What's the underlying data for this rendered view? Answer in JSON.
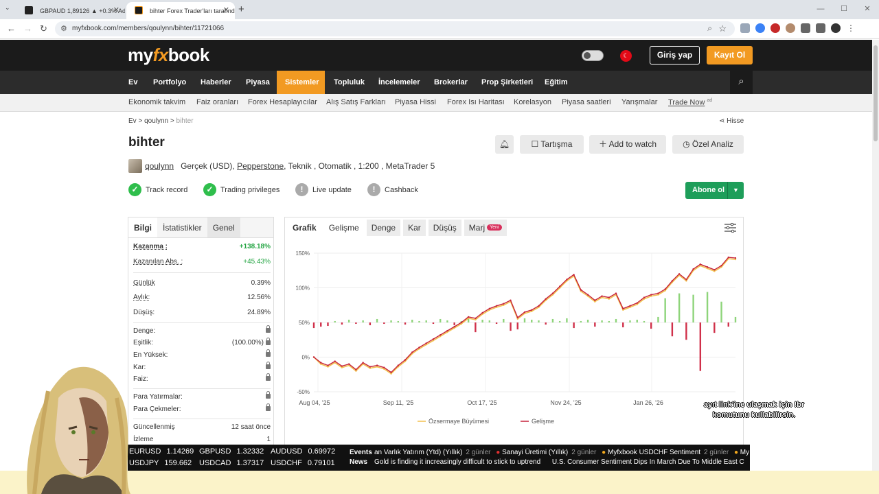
{
  "browser": {
    "tabs": [
      {
        "title": "GBPAUD 1,89126 ▲ +0.3% Adsız",
        "active": false
      },
      {
        "title": "bihter Forex Trader'ları tarafından",
        "active": true
      }
    ],
    "url": "myfxbook.com/members/qoulynn/bihter/11721066"
  },
  "header": {
    "logo": {
      "a": "my",
      "b": "fx",
      "c": "book"
    },
    "login": "Giriş yap",
    "register": "Kayıt Ol"
  },
  "nav": {
    "items": [
      "Ev",
      "Portfolyo",
      "Haberler",
      "Piyasa",
      "Sistemler",
      "Topluluk",
      "İncelemeler",
      "Brokerlar",
      "Prop Şirketleri",
      "Eğitim"
    ],
    "active": "Sistemler"
  },
  "subnav": {
    "items": [
      "Ekonomik takvim",
      "Faiz oranları",
      "Forex Hesaplayıcılar",
      "Alış Satış Farkları",
      "Piyasa Hissi",
      "Forex Isı Haritası",
      "Korelasyon",
      "Piyasa saatleri",
      "Yarışmalar",
      "Trade Now"
    ],
    "ad": "ad"
  },
  "breadcrumb": {
    "home": "Ev",
    "user": "qoulynn",
    "current": "bihter",
    "share": "Hisse"
  },
  "system": {
    "name": "bihter",
    "user": "qoulynn",
    "account_type": "Gerçek (USD),",
    "broker": "Pepperstone",
    "details": ", Teknik , Otomatik , 1:200 , MetaTrader 5"
  },
  "actions": {
    "discussion": "Tartışma",
    "watch": "Add to watch",
    "analysis": "Özel Analiz"
  },
  "badges": [
    {
      "label": "Track record",
      "status": "ok"
    },
    {
      "label": "Trading privileges",
      "status": "ok"
    },
    {
      "label": "Live update",
      "status": "na"
    },
    {
      "label": "Cashback",
      "status": "na"
    }
  ],
  "subscribe": "Abone ol",
  "info": {
    "tabs": [
      "Bilgi",
      "İstatistikler",
      "Genel"
    ],
    "gain_label": "Kazanma :",
    "gain": "+138.18%",
    "abs_gain_label": "Kazanılan Abs. :",
    "abs_gain": "+45.43%",
    "daily_label": "Günlük",
    "daily": "0.39%",
    "monthly_label": "Aylık:",
    "monthly": "12.56%",
    "drawdown_label": "Düşüş:",
    "drawdown": "24.89%",
    "balance_label": "Denge:",
    "equity_label": "Eşitlik:",
    "equity": "(100.00%)",
    "highest_label": "En Yüksek:",
    "profit_label": "Kar:",
    "interest_label": "Faiz:",
    "deposits_label": "Para Yatırmalar:",
    "withdrawals_label": "Para Çekmeler:",
    "updated_label": "Güncellenmiş",
    "updated": "12 saat önce",
    "watching_label": "İzleme",
    "watching": "1"
  },
  "chart_tabs": {
    "title": "Grafik",
    "tabs": [
      "Gelişme",
      "Denge",
      "Kar",
      "Düşüş",
      "Marj"
    ],
    "new_badge": "Yeni"
  },
  "chart_data": {
    "type": "line",
    "x_ticks": [
      "Aug 04, '25",
      "Sep 11, '25",
      "Oct 17, '25",
      "Nov 24, '25",
      "Jan 26, '26"
    ],
    "y_ticks": [
      "150%",
      "100%",
      "50%",
      "0%",
      "-50%"
    ],
    "ylim": [
      -50,
      150
    ],
    "series": [
      {
        "name": "Özsermaye Büyümesi",
        "color": "#f2c14e",
        "values": [
          0,
          -10,
          -14,
          -8,
          -15,
          -12,
          -20,
          -10,
          -16,
          -14,
          -17,
          -24,
          -14,
          -6,
          5,
          12,
          18,
          24,
          30,
          36,
          42,
          48,
          56,
          54,
          62,
          68,
          72,
          75,
          80,
          55,
          63,
          66,
          72,
          82,
          90,
          100,
          110,
          117,
          95,
          88,
          80,
          86,
          84,
          90,
          68,
          72,
          76,
          84,
          88,
          90,
          96,
          108,
          118,
          110,
          125,
          132,
          128,
          124,
          130,
          142,
          141
        ]
      },
      {
        "name": "Gelişme",
        "color": "#c6233a",
        "values": [
          0,
          -8,
          -12,
          -6,
          -13,
          -10,
          -18,
          -8,
          -14,
          -12,
          -15,
          -22,
          -12,
          -4,
          7,
          14,
          20,
          26,
          32,
          38,
          44,
          50,
          58,
          56,
          64,
          70,
          74,
          77,
          82,
          57,
          65,
          68,
          74,
          84,
          92,
          102,
          112,
          119,
          97,
          90,
          82,
          88,
          86,
          92,
          70,
          74,
          78,
          86,
          90,
          92,
          98,
          110,
          120,
          112,
          127,
          134,
          130,
          126,
          132,
          144,
          143
        ]
      },
      {
        "name": "daily_bars",
        "values": [
          -8,
          -6,
          -5,
          2,
          -3,
          4,
          -2,
          3,
          -4,
          5,
          -2,
          3,
          2,
          -3,
          4,
          2,
          3,
          -2,
          5,
          3,
          -4,
          2,
          6,
          -14,
          4,
          3,
          -2,
          5,
          -12,
          -10,
          6,
          4,
          3,
          -3,
          5,
          2,
          6,
          -8,
          2,
          4,
          -6,
          3,
          2,
          5,
          -7,
          3,
          4,
          2,
          -9,
          8,
          35,
          -20,
          42,
          -25,
          40,
          -70,
          44,
          -15,
          30,
          -6,
          8
        ]
      }
    ],
    "legend": [
      "Özsermaye Büyümesi",
      "Gelişme"
    ]
  },
  "ticker": {
    "quotes": [
      {
        "sym": "EURUSD",
        "val": "1.14269"
      },
      {
        "sym": "GBPUSD",
        "val": "1.32332"
      },
      {
        "sym": "AUDUSD",
        "val": "0.69972"
      },
      {
        "sym": "USDJPY",
        "val": "159.662"
      },
      {
        "sym": "USDCAD",
        "val": "1.37317"
      },
      {
        "sym": "USDCHF",
        "val": "0.79101"
      }
    ],
    "events_label": "Events",
    "events": [
      {
        "text": "an Varlık Yatırım (Ytd) (Yıllık)",
        "ago": "2 günler"
      },
      {
        "text": "Sanayi Üretimi (Yıllık)",
        "ago": "2 günler"
      },
      {
        "text": "Myfxbook USDCHF Sentiment",
        "ago": "2 günler"
      },
      {
        "text": "My",
        "ago": ""
      }
    ],
    "news_label": "News",
    "news": [
      "Gold is finding it increasingly difficult to stick to uptrend",
      "U.S. Consumer Sentiment Dips In March Due To Middle East C"
    ]
  },
  "overlay": {
    "line1": "ayıt link'ine ulaşmak için !br",
    "line2": "komutunu kullabilirsin."
  }
}
